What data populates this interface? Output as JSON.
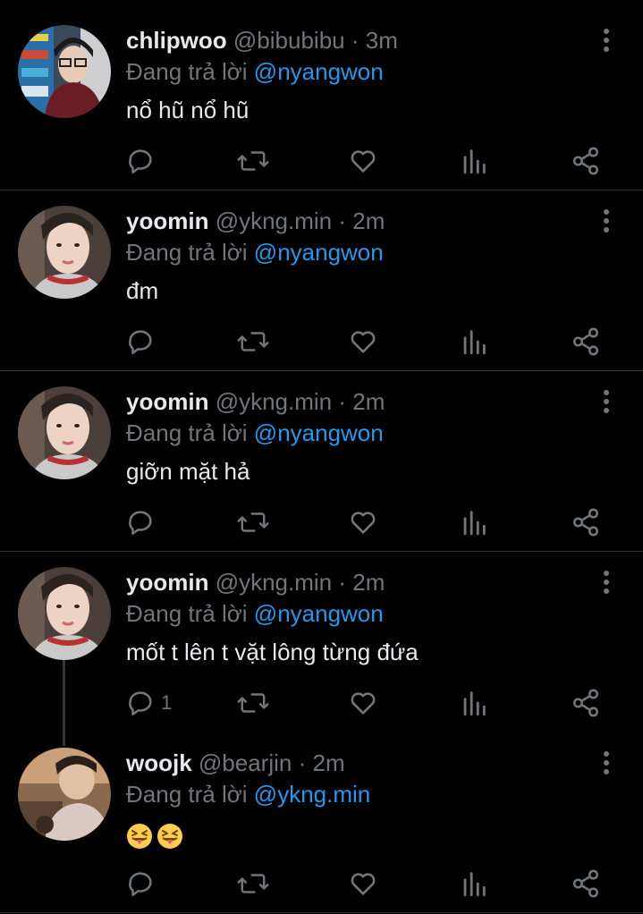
{
  "tweets": [
    {
      "name": "chlipwoo",
      "handle": "@bibubibu",
      "dot": "·",
      "time": "3m",
      "reply_prefix": "Đang trả lời",
      "reply_to": "@nyangwon",
      "text": "nổ hũ nổ hũ",
      "reply_count": ""
    },
    {
      "name": "yoomin",
      "handle": "@ykng.min",
      "dot": "·",
      "time": "2m",
      "reply_prefix": "Đang trả lời",
      "reply_to": "@nyangwon",
      "text": "đm",
      "reply_count": ""
    },
    {
      "name": "yoomin",
      "handle": "@ykng.min",
      "dot": "·",
      "time": "2m",
      "reply_prefix": "Đang trả lời",
      "reply_to": "@nyangwon",
      "text": "giỡn mặt hả",
      "reply_count": ""
    },
    {
      "name": "yoomin",
      "handle": "@ykng.min",
      "dot": "·",
      "time": "2m",
      "reply_prefix": "Đang trả lời",
      "reply_to": "@nyangwon",
      "text": "mốt t lên t vặt lông từng đứa",
      "reply_count": "1"
    },
    {
      "name": "woojk",
      "handle": "@bearjin",
      "dot": "·",
      "time": "2m",
      "reply_prefix": "Đang trả lời",
      "reply_to": "@ykng.min",
      "text": "",
      "emojis": [
        "squinting-face-with-tongue",
        "squinting-face-with-tongue"
      ],
      "reply_count": ""
    }
  ],
  "icons": {
    "reply": "reply-icon",
    "retweet": "retweet-icon",
    "like": "like-icon",
    "views": "views-icon",
    "share": "share-icon",
    "more": "more-options-icon"
  },
  "colors": {
    "background": "#000000",
    "text": "#e7e9ea",
    "muted": "#71767b",
    "mention": "#1d9bf0",
    "divider": "#2f3336"
  }
}
